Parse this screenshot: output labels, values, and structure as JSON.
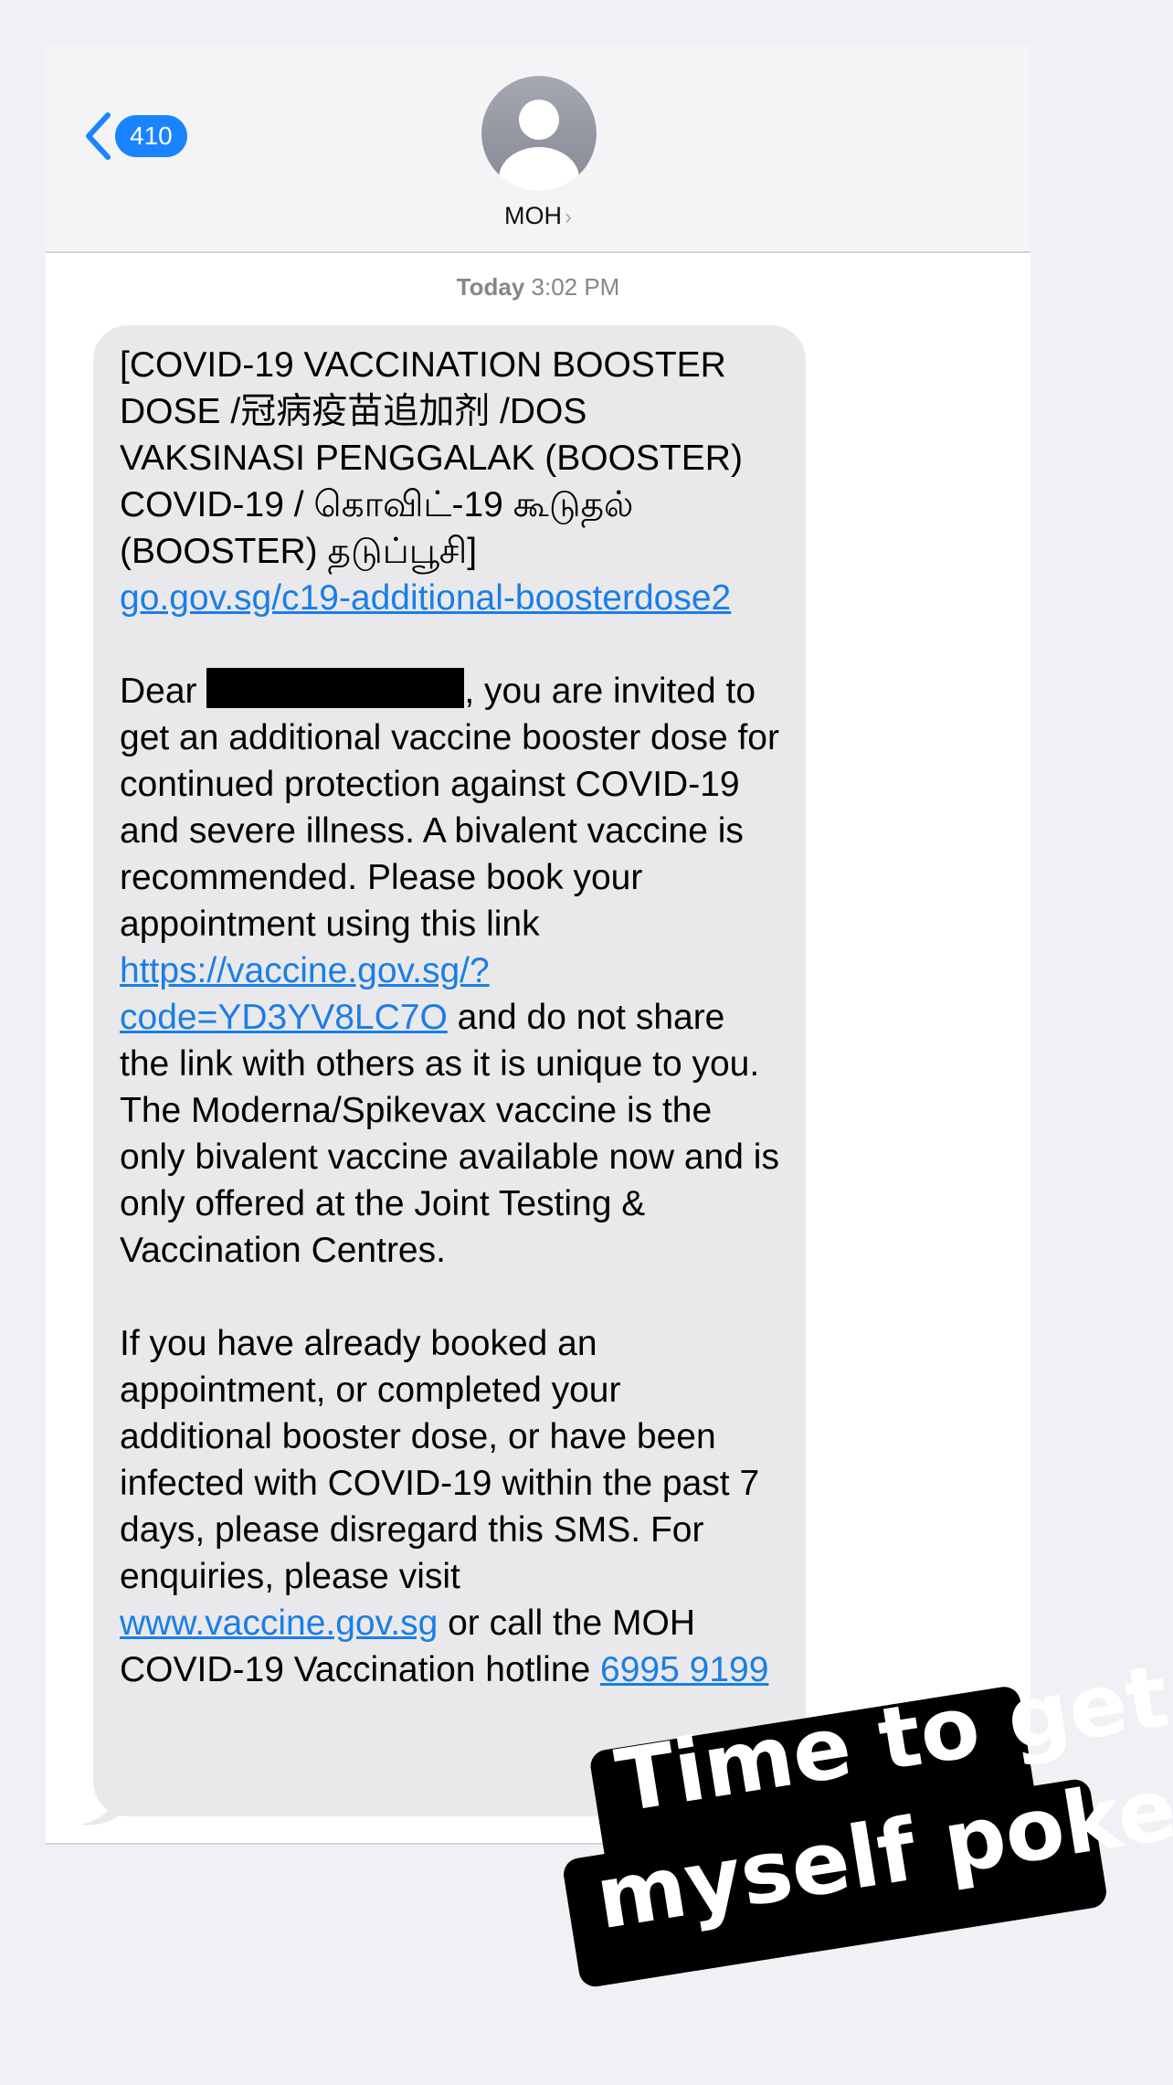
{
  "header": {
    "back_count": "410",
    "contact_name": "MOH",
    "contact_chevron": "›"
  },
  "thread": {
    "timestamp_day": "Today",
    "timestamp_time": "3:02 PM"
  },
  "message": {
    "title": "[COVID-19 VACCINATION BOOSTER DOSE /冠病疫苗追加剂 /DOS VAKSINASI PENGGALAK (BOOSTER) COVID-19 / கொவிட்-19 கூடுதல் (BOOSTER) தடுப்பூசி]",
    "title_link": "go.gov.sg/c19-additional-boosterdose2",
    "greeting": "Dear ",
    "body_1": ", you are invited to get an additional vaccine booster dose for continued protection against COVID-19 and severe illness. A bivalent vaccine is recommended. Please book your appointment using this link ",
    "booking_link": "https://vaccine.gov.sg/?code=YD3YV8LC7O",
    "body_2": " and do not share the link with others as it is unique to you. The Moderna/Spikevax vaccine is the only bivalent vaccine available now and is only offered at the Joint Testing & Vaccination Centres.",
    "body_3": "If you have already booked an appointment, or completed your additional booster dose, or have been infected with COVID-19 within the past 7 days, please disregard this SMS. For enquiries, please visit ",
    "site_link": "www.vaccine.gov.sg",
    "body_4": " or call the MOH COVID-19 Vaccination hotline ",
    "hotline": "6995 9199"
  },
  "sticker": {
    "line_1": "Time to get",
    "line_2": "myself poked"
  },
  "colors": {
    "accent": "#1a84ff",
    "link": "#1a7ee6",
    "bubble": "#e9e9eb",
    "background": "#eff1f4"
  },
  "icons": {
    "back": "chevron-left-icon",
    "avatar": "person-placeholder-icon"
  }
}
